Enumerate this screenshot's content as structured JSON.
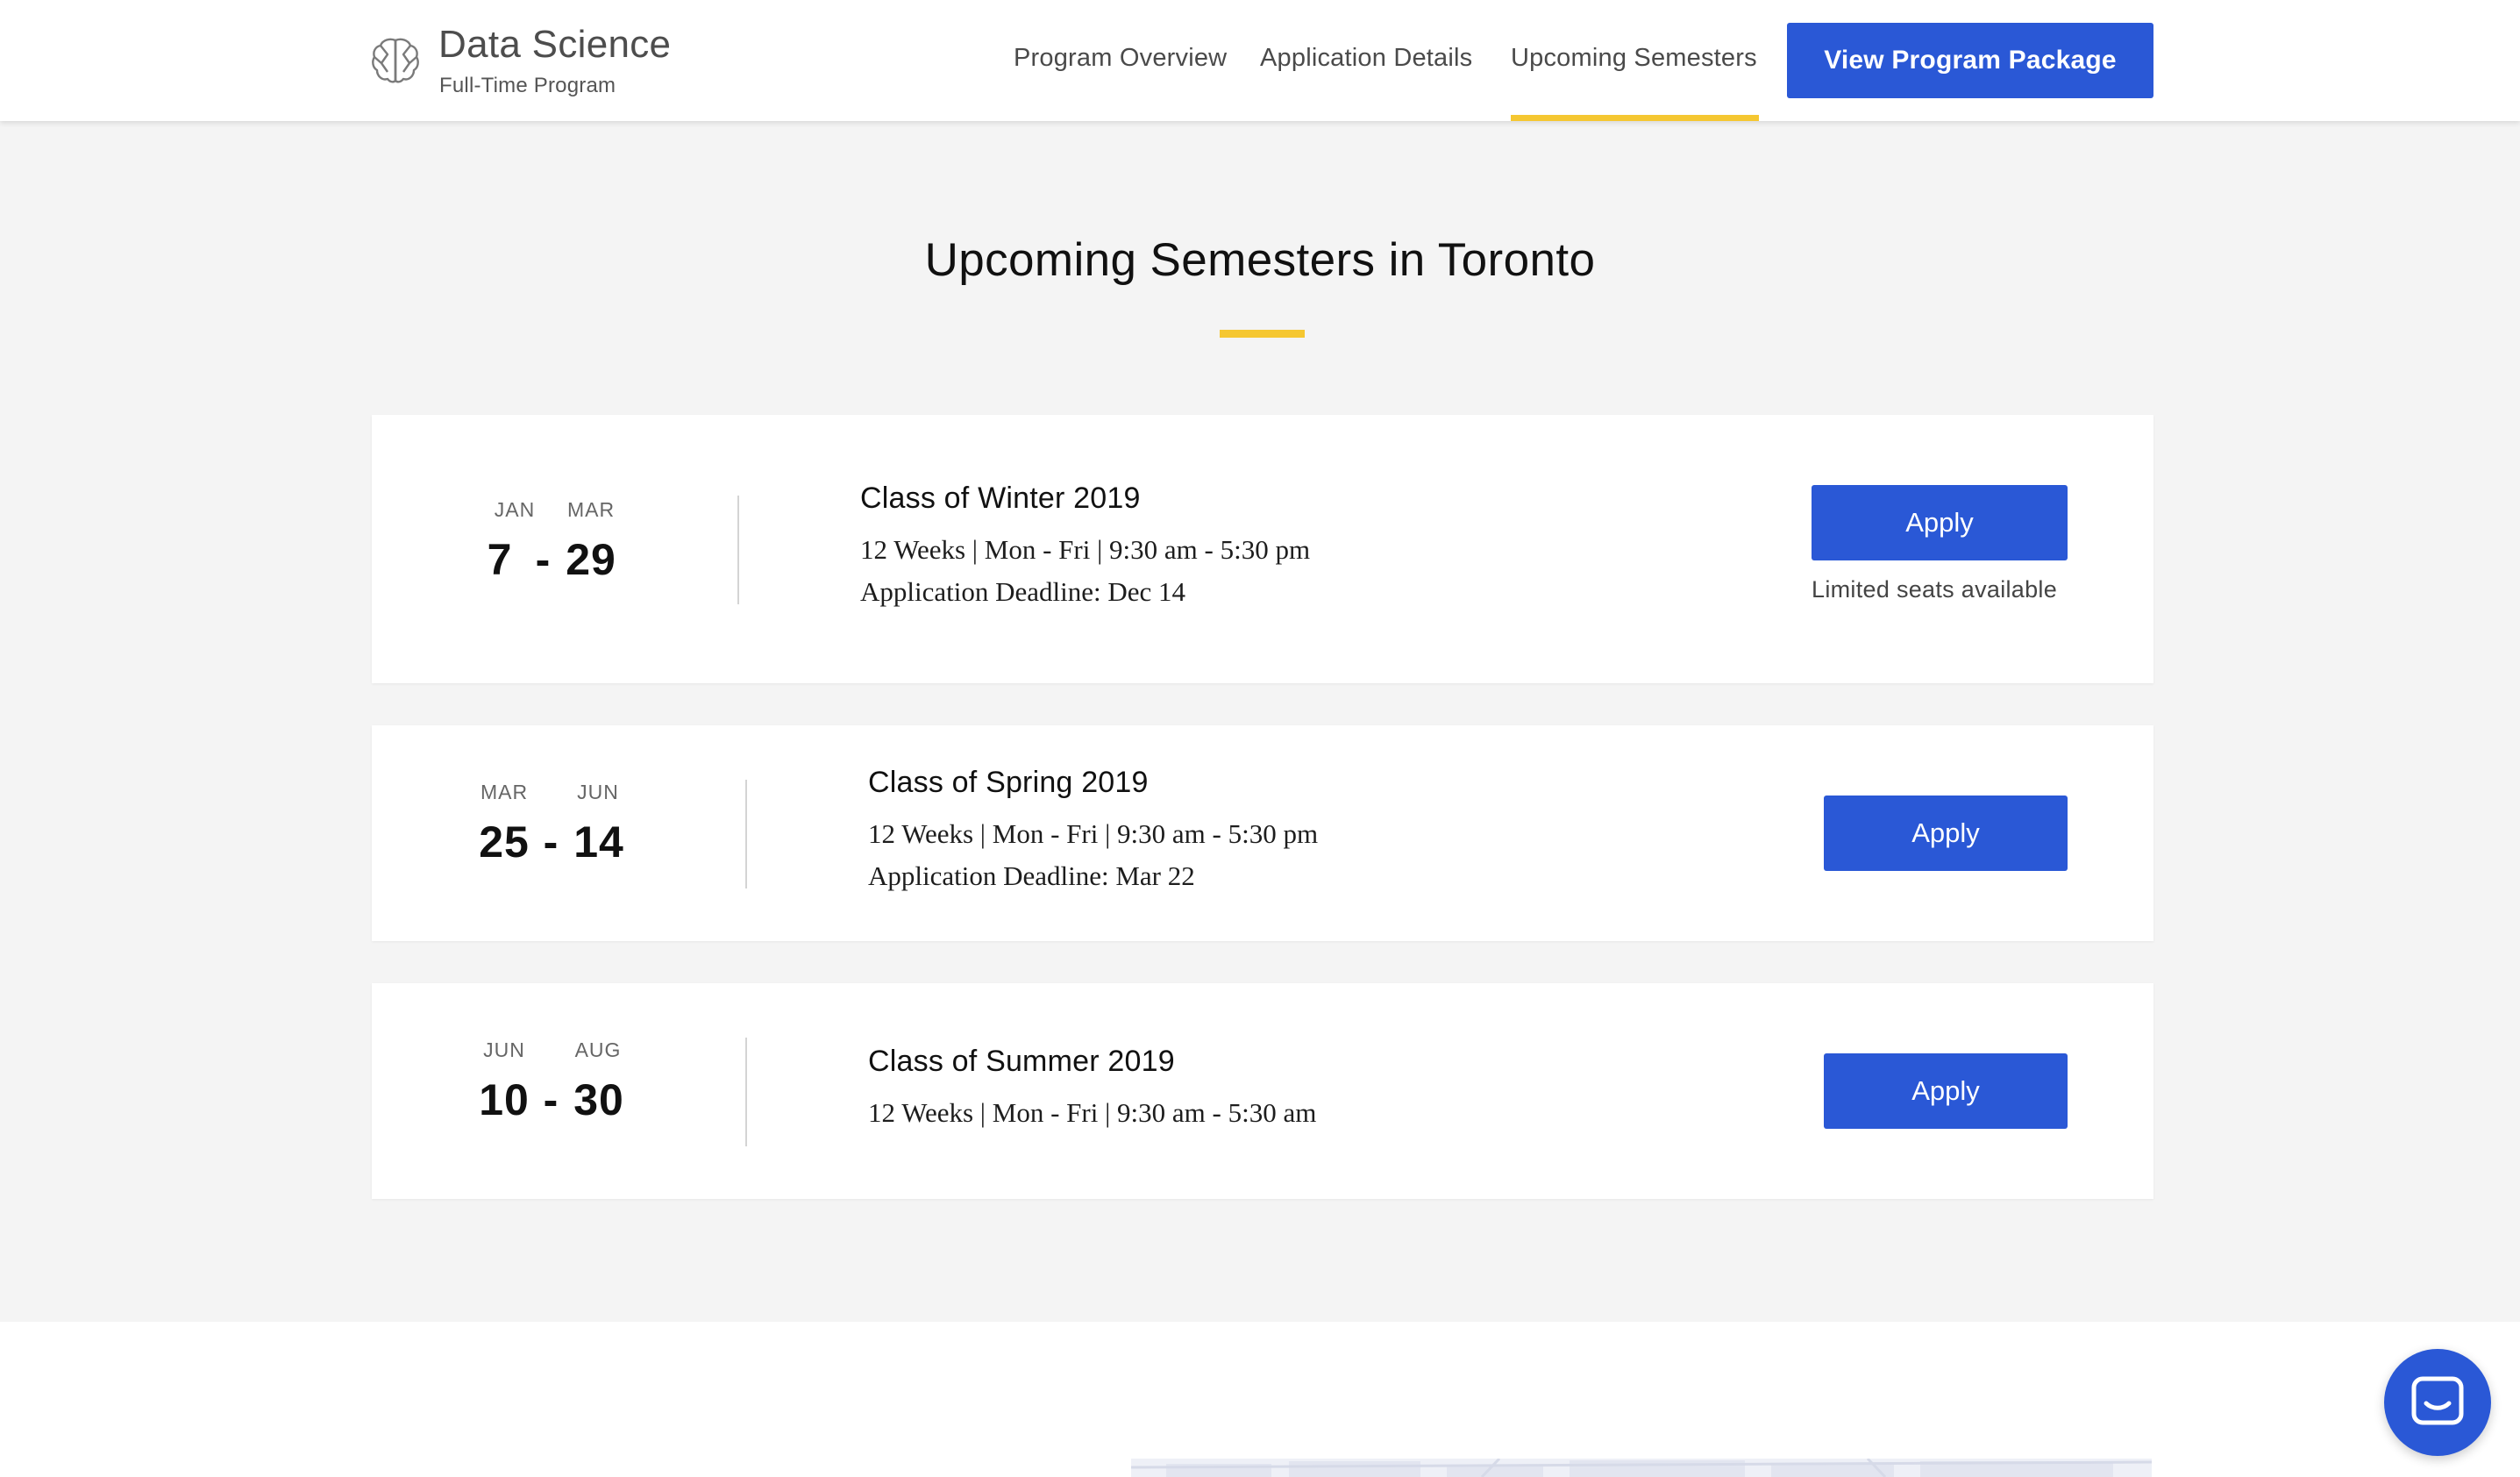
{
  "brand": {
    "title": "Data Science",
    "subtitle": "Full-Time Program",
    "icon": "brain-icon"
  },
  "nav": {
    "items": [
      {
        "label": "Program Overview",
        "active": false
      },
      {
        "label": "Application Details",
        "active": false
      },
      {
        "label": "Upcoming Semesters",
        "active": true
      }
    ],
    "cta_label": "View Program Package"
  },
  "section": {
    "title": "Upcoming Semesters in Toronto"
  },
  "semesters": [
    {
      "start_month": "JAN",
      "start_day": "7",
      "end_month": "MAR",
      "end_day": "29",
      "title": "Class of Winter 2019",
      "schedule": "12 Weeks | Mon - Fri | 9:30 am - 5:30 pm",
      "deadline": "Application Deadline: Dec 14",
      "apply_label": "Apply",
      "note": "Limited seats available"
    },
    {
      "start_month": "MAR",
      "start_day": "25",
      "end_month": "JUN",
      "end_day": "14",
      "title": "Class of Spring 2019",
      "schedule": "12 Weeks | Mon - Fri | 9:30 am - 5:30 pm",
      "deadline": "Application Deadline: Mar 22",
      "apply_label": "Apply"
    },
    {
      "start_month": "JUN",
      "start_day": "10",
      "end_month": "AUG",
      "end_day": "30",
      "title": "Class of Summer 2019",
      "schedule": "12 Weeks | Mon - Fri | 9:30 am - 5:30 am",
      "apply_label": "Apply"
    }
  ],
  "range_separator": "-",
  "chat": {
    "icon": "chat-icon"
  },
  "colors": {
    "accent_blue": "#2a58d6",
    "accent_yellow": "#f5c731",
    "page_bg": "#f4f4f4"
  }
}
